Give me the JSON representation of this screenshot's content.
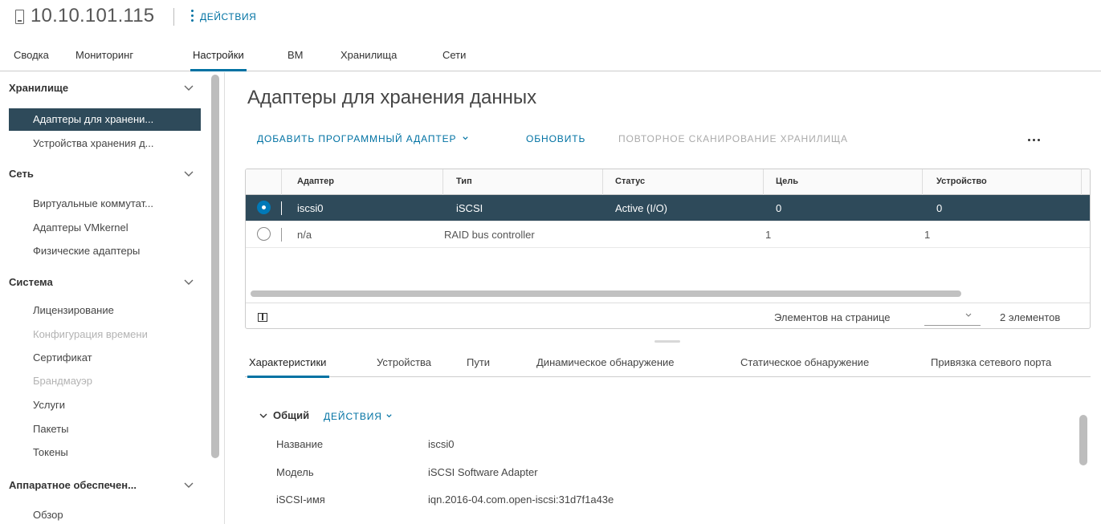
{
  "header": {
    "host": "10.10.101.115",
    "actions_label": "ДЕЙСТВИЯ"
  },
  "top_tabs": [
    {
      "label": "Сводка"
    },
    {
      "label": "Мониторинг"
    },
    {
      "label": "Настройки",
      "active": true
    },
    {
      "label": "ВМ"
    },
    {
      "label": "Хранилища"
    },
    {
      "label": "Сети"
    }
  ],
  "sidebar": {
    "groups": [
      {
        "label": "Хранилище",
        "items": [
          "Адаптеры для хранени...",
          "Устройства хранения д..."
        ]
      },
      {
        "label": "Сеть",
        "items": [
          "Виртуальные коммутат...",
          "Адаптеры VMkernel",
          "Физические адаптеры"
        ]
      },
      {
        "label": "Система",
        "items": [
          "Лицензирование",
          "Конфигурация времени",
          "Сертификат",
          "Брандмауэр",
          "Услуги",
          "Пакеты",
          "Токены"
        ]
      },
      {
        "label": "Аппаратное обеспечен...",
        "items": [
          "Обзор"
        ]
      }
    ]
  },
  "main": {
    "title": "Адаптеры для хранения данных",
    "toolbar": {
      "add_adapter": "ДОБАВИТЬ ПРОГРАММНЫЙ АДАПТЕР",
      "refresh": "ОБНОВИТЬ",
      "rescan": "ПОВТОРНОЕ СКАНИРОВАНИЕ ХРАНИЛИЩА"
    },
    "grid": {
      "columns": [
        "Адаптер",
        "Тип",
        "Статус",
        "Цель",
        "Устройство"
      ],
      "rows": [
        {
          "adapter": "iscsi0",
          "type": "iSCSI",
          "status": "Active (I/O)",
          "target": "0",
          "device": "0",
          "selected": true
        },
        {
          "adapter": "n/a",
          "type": "RAID bus controller",
          "status": "",
          "target": "1",
          "device": "1",
          "selected": false
        }
      ],
      "footer": {
        "page_size_label": "Элементов на странице",
        "count_label": "2 элементов"
      }
    },
    "detail_tabs": [
      {
        "label": "Характеристики",
        "active": true
      },
      {
        "label": "Устройства"
      },
      {
        "label": "Пути"
      },
      {
        "label": "Динамическое обнаружение"
      },
      {
        "label": "Статическое обнаружение"
      },
      {
        "label": "Привязка сетевого порта"
      }
    ],
    "details": {
      "section_title": "Общий",
      "section_actions": "ДЕЙСТВИЯ",
      "properties": [
        {
          "label": "Название",
          "value": "iscsi0"
        },
        {
          "label": "Модель",
          "value": "iSCSI Software Adapter"
        },
        {
          "label": "iSCSI-имя",
          "value": "iqn.2016-04.com.open-iscsi:31d7f1a43e"
        }
      ]
    }
  },
  "colors": {
    "accent": "#0072a3",
    "selected_bg": "#2e4a5a",
    "disabled": "#b3b3b3"
  }
}
